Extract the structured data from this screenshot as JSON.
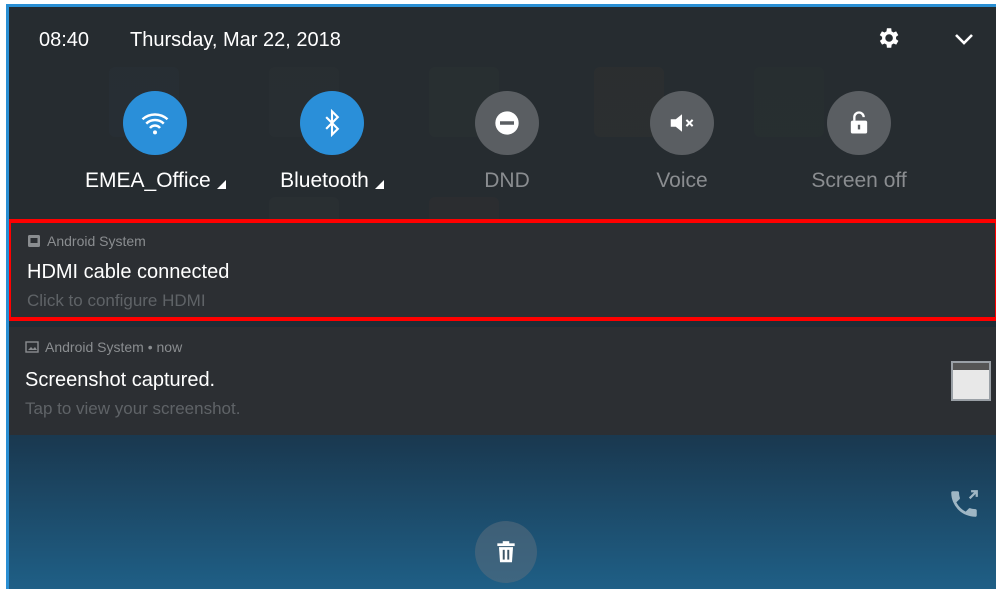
{
  "status_bar": {
    "time": "08:40",
    "date": "Thursday, Mar 22, 2018",
    "settings_icon": "gear-icon",
    "expand_icon": "chevron-down-icon"
  },
  "quick_settings": [
    {
      "label": "EMEA_Office",
      "icon": "wifi-icon",
      "state": "on",
      "has_menu": true
    },
    {
      "label": "Bluetooth",
      "icon": "bluetooth-icon",
      "state": "on",
      "has_menu": true
    },
    {
      "label": "DND",
      "icon": "dnd-icon",
      "state": "off",
      "has_menu": false
    },
    {
      "label": "Voice",
      "icon": "mute-icon",
      "state": "off",
      "has_menu": false
    },
    {
      "label": "Screen off",
      "icon": "lock-icon",
      "state": "off",
      "has_menu": false
    }
  ],
  "notifications": [
    {
      "app": "Android System",
      "title": "HDMI cable connected",
      "subtitle": "Click to configure HDMI",
      "highlighted": true
    },
    {
      "app": "Android System • now",
      "title": "Screenshot captured.",
      "subtitle": "Tap to view your screenshot.",
      "has_thumbnail": true
    }
  ],
  "clear_all_icon": "trash-icon",
  "colors": {
    "accent": "#2a8fd9",
    "highlight_border": "#ff0000",
    "shade": "#2c2f33"
  }
}
